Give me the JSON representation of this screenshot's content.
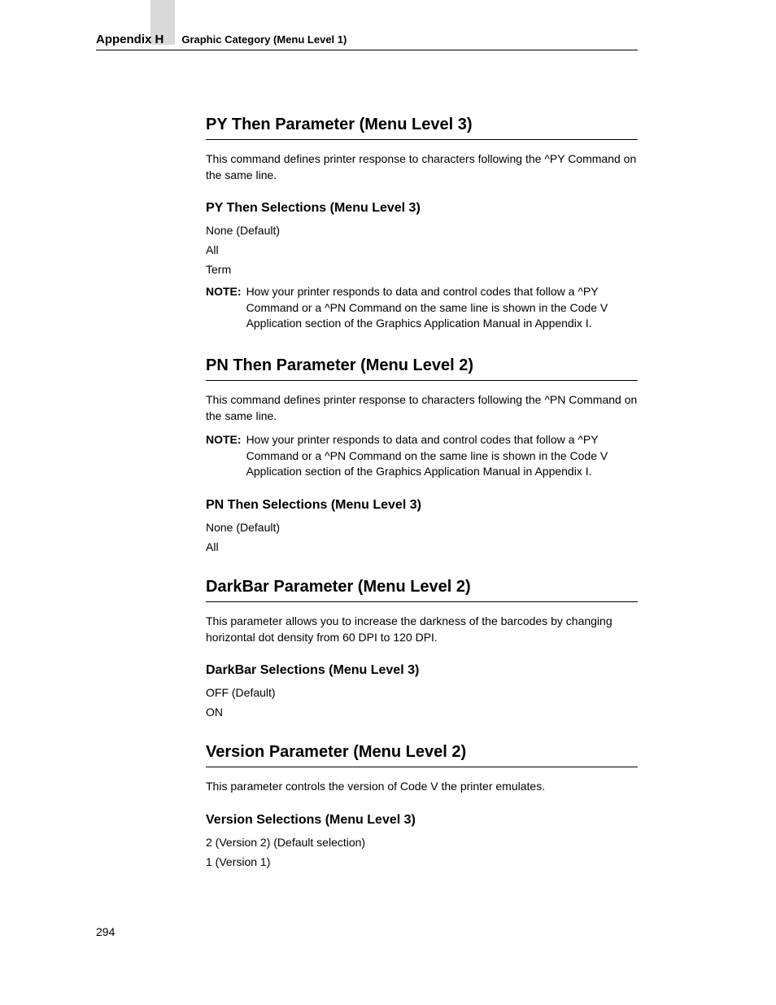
{
  "header": {
    "appendix": "Appendix H",
    "title": "Graphic Category (Menu Level 1)"
  },
  "sections": {
    "pyThen": {
      "heading": "PY Then Parameter (Menu Level 3)",
      "desc": "This command defines printer response to characters following the ^PY Command on the same line.",
      "subheading": "PY Then Selections (Menu Level 3)",
      "items": [
        "None (Default)",
        "All",
        "Term"
      ],
      "noteLabel": "NOTE:",
      "noteText": "How your printer responds to data and control codes that follow a ^PY Command or a ^PN Command on the same line is shown in the Code V Application section of the Graphics Application Manual in Appendix I."
    },
    "pnThen": {
      "heading": "PN Then Parameter (Menu Level 2)",
      "desc": "This command defines printer response to characters following the ^PN Command on the same line.",
      "noteLabel": "NOTE:",
      "noteText": "How your printer responds to data and control codes that follow a ^PY Command or a ^PN Command on the same line is shown in the Code V Application section of the Graphics Application Manual in Appendix I.",
      "subheading": "PN Then Selections (Menu Level 3)",
      "items": [
        "None (Default)",
        "All"
      ]
    },
    "darkBar": {
      "heading": "DarkBar Parameter (Menu Level 2)",
      "desc": "This parameter allows you to increase the darkness of the barcodes by changing horizontal dot density from 60 DPI to 120 DPI.",
      "subheading": "DarkBar Selections (Menu Level 3)",
      "items": [
        "OFF (Default)",
        "ON"
      ]
    },
    "version": {
      "heading": "Version Parameter (Menu Level 2)",
      "desc": "This parameter controls the version of Code V the printer emulates.",
      "subheading": "Version Selections (Menu Level 3)",
      "items": [
        "2 (Version 2) (Default selection)",
        "1 (Version 1)"
      ]
    }
  },
  "pageNumber": "294"
}
